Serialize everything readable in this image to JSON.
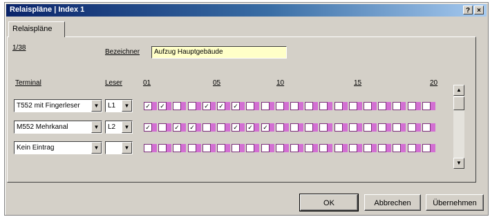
{
  "window": {
    "title": "Relaispläne | Index 1"
  },
  "titlebar_buttons": {
    "help": "?",
    "close": "×"
  },
  "tab": {
    "label": "Relaispläne"
  },
  "form": {
    "index_label": "1/38",
    "bezeichner_label": "Bezeichner",
    "bezeichner_value": "Aufzug Hauptgebäude"
  },
  "grid": {
    "terminal_header": "Terminal",
    "leser_header": "Leser",
    "column_numbers": [
      "01",
      "05",
      "10",
      "15",
      "20"
    ],
    "rows": [
      {
        "terminal": "T552 mit Fingerleser",
        "leser": "L1",
        "checked": [
          1,
          2,
          5,
          6,
          7
        ]
      },
      {
        "terminal": "M552 Mehrkanal",
        "leser": "L2",
        "checked": [
          1,
          3,
          4,
          7,
          8,
          9
        ]
      },
      {
        "terminal": "Kein Eintrag",
        "leser": "",
        "checked": []
      }
    ]
  },
  "buttons": {
    "ok": "OK",
    "cancel": "Abbrechen",
    "apply": "Übernehmen"
  },
  "colors": {
    "relay_accent": "#d36fd3",
    "title_gradient_start": "#0a246a",
    "field_highlight": "#ffffc8"
  }
}
